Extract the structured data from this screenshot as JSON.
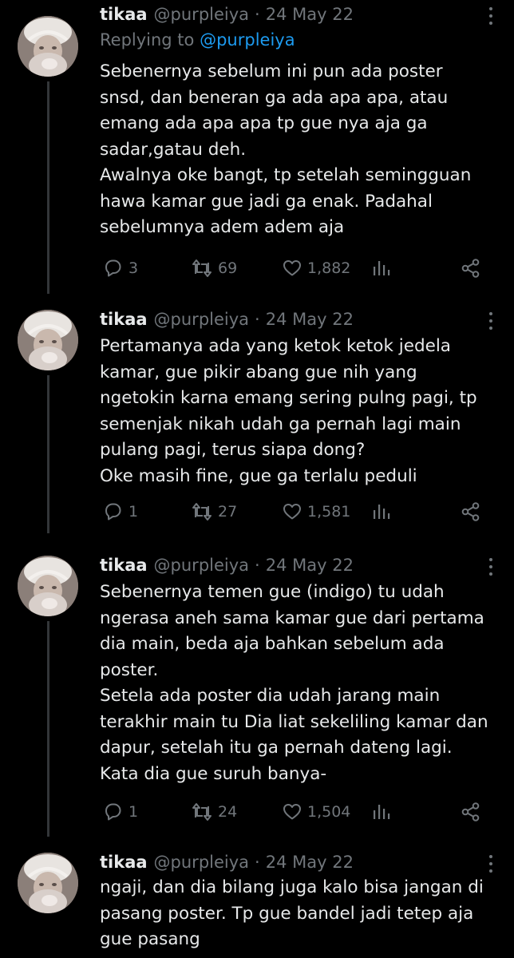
{
  "tweets": [
    {
      "name": "tikaa",
      "handle": "@purpleiya",
      "separator": "·",
      "date": "24 May 22",
      "replying_label": "Replying to",
      "replying_mention": "@purpleiya",
      "lines": [
        "Sebenernya sebelum ini pun ada poster",
        "snsd, dan beneran ga ada apa apa, atau",
        "emang ada apa apa tp gue nya aja ga",
        "sadar,gatau deh.",
        "Awalnya oke bangt, tp setelah semingguan",
        "hawa kamar gue jadi ga enak. Padahal",
        "sebelumnya adem adem aja"
      ],
      "replies": "3",
      "retweets": "69",
      "likes": "1,882"
    },
    {
      "name": "tikaa",
      "handle": "@purpleiya",
      "separator": "·",
      "date": "24 May 22",
      "lines": [
        "Pertamanya ada yang ketok ketok jedela",
        "kamar, gue pikir abang gue nih yang",
        "ngetokin karna emang sering pulng pagi, tp",
        "semenjak nikah udah ga pernah lagi main",
        "pulang pagi, terus siapa dong?",
        "Oke masih fine, gue ga terlalu peduli"
      ],
      "replies": "1",
      "retweets": "27",
      "likes": "1,581"
    },
    {
      "name": "tikaa",
      "handle": "@purpleiya",
      "separator": "·",
      "date": "24 May 22",
      "lines": [
        "Sebenernya temen gue (indigo) tu udah",
        "ngerasa aneh sama kamar gue dari pertama",
        "dia main, beda aja bahkan sebelum ada",
        "poster.",
        "Setela ada poster dia udah jarang main",
        "terakhir main tu Dia liat sekeliling kamar dan",
        "dapur, setelah itu ga pernah dateng lagi.",
        "Kata dia gue suruh banya-"
      ],
      "replies": "1",
      "retweets": "24",
      "likes": "1,504"
    },
    {
      "name": "tikaa",
      "handle": "@purpleiya",
      "separator": "·",
      "date": "24 May 22",
      "lines": [
        "ngaji, dan dia bilang juga kalo bisa jangan di",
        "pasang poster. Tp gue bandel jadi tetep aja",
        "gue pasang"
      ]
    }
  ],
  "icons": {
    "reply": "reply-icon",
    "retweet": "retweet-icon",
    "like": "heart-icon",
    "views": "analytics-icon",
    "share": "share-icon",
    "more": "more-icon"
  },
  "colors": {
    "background": "#000000",
    "text": "#e7e9ea",
    "secondary": "#71767b",
    "link": "#1d9bf0",
    "thread_line": "#333639"
  }
}
